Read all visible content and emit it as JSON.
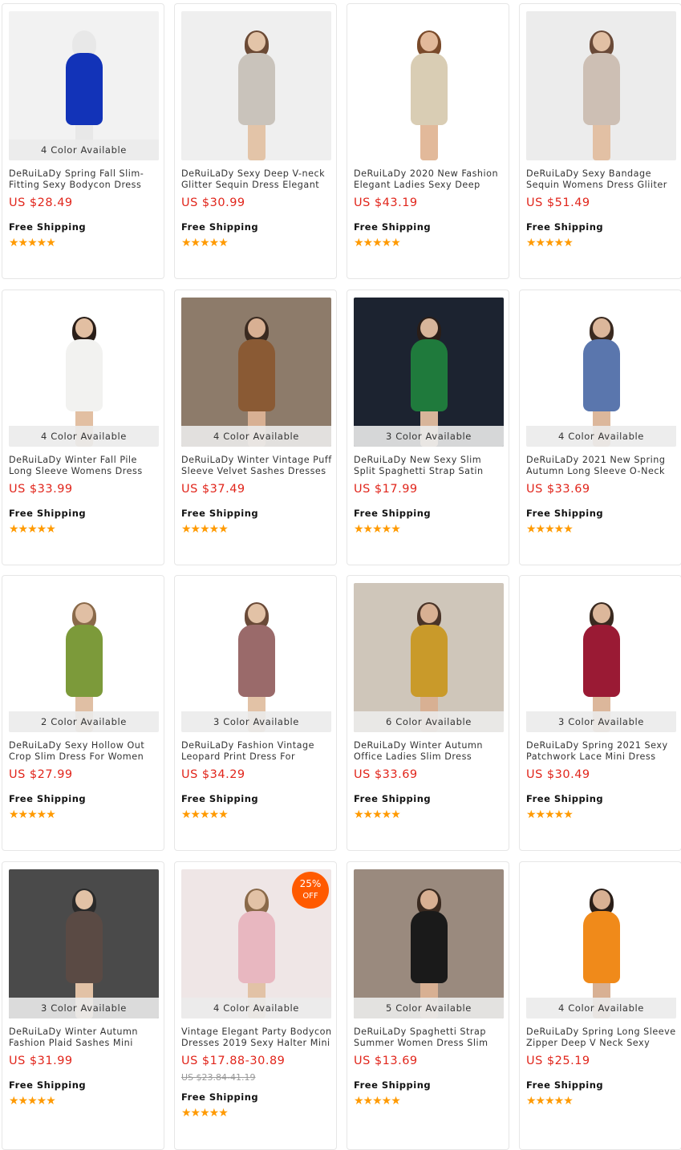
{
  "products": [
    {
      "name": "DeRuiLaDy Spring Fall Slim-Fitting Sexy Bodycon Dress For",
      "price": "US $28.49",
      "colors": "4 Color Available",
      "shipping": "Free Shipping",
      "rating": "★★★★★",
      "bg": "#f2f2f2",
      "dress": "#1233b8",
      "skin": "#e8e8e8",
      "hair": "#e8e8e8"
    },
    {
      "name": "DeRuiLaDy Sexy Deep V-neck Glitter Sequin Dress Elegant",
      "price": "US $30.99",
      "colors": "",
      "shipping": "Free Shipping",
      "rating": "★★★★★",
      "bg": "#efefef",
      "dress": "#c9c3bb",
      "skin": "#e3c4a8",
      "hair": "#6b4a35"
    },
    {
      "name": "DeRuiLaDy 2020 New Fashion Elegant Ladies Sexy Deep",
      "price": "US $43.19",
      "colors": "",
      "shipping": "Free Shipping",
      "rating": "★★★★★",
      "bg": "#ffffff",
      "dress": "#d9cdb4",
      "skin": "#e2b99a",
      "hair": "#7a4a2a"
    },
    {
      "name": "DeRuiLaDy Sexy Bandage Sequin Womens Dress Gliiter",
      "price": "US $51.49",
      "colors": "",
      "shipping": "Free Shipping",
      "rating": "★★★★★",
      "bg": "#ececec",
      "dress": "#cdbfb4",
      "skin": "#e2c0a4",
      "hair": "#6a4a38"
    },
    {
      "name": "DeRuiLaDy Winter Fall Pile Long Sleeve Womens Dress Vintage",
      "price": "US $33.99",
      "colors": "4 Color Available",
      "shipping": "Free Shipping",
      "rating": "★★★★★",
      "bg": "#ffffff",
      "dress": "#f2f2f0",
      "skin": "#e2bfa2",
      "hair": "#2a1e18"
    },
    {
      "name": "DeRuiLaDy Winter Vintage Puff Sleeve Velvet Sashes Dresses",
      "price": "US $37.49",
      "colors": "4 Color Available",
      "shipping": "Free Shipping",
      "rating": "★★★★★",
      "bg": "#8d7b6a",
      "dress": "#8a5a34",
      "skin": "#d8b093",
      "hair": "#3a2a20"
    },
    {
      "name": "DeRuiLaDy New Sexy Slim Split Spaghetti Strap Satin Dress For",
      "price": "US $17.99",
      "colors": "3 Color Available",
      "shipping": "Free Shipping",
      "rating": "★★★★★",
      "bg": "#1c2330",
      "dress": "#1f7a3c",
      "skin": "#d8b59a",
      "hair": "#2a1e18"
    },
    {
      "name": "DeRuiLaDy 2021 New Spring Autumn Long Sleeve O-Neck",
      "price": "US $33.69",
      "colors": "4 Color Available",
      "shipping": "Free Shipping",
      "rating": "★★★★★",
      "bg": "#ffffff",
      "dress": "#5a76ad",
      "skin": "#dcb79b",
      "hair": "#3a2a20"
    },
    {
      "name": "DeRuiLaDy Sexy Hollow Out Crop Slim Dress For Women",
      "price": "US $27.99",
      "colors": "2 Color Available",
      "shipping": "Free Shipping",
      "rating": "★★★★★",
      "bg": "#ffffff",
      "dress": "#7c9a3a",
      "skin": "#e0bfa4",
      "hair": "#8a6a4a"
    },
    {
      "name": "DeRuiLaDy Fashion Vintage Leopard Print Dress For Women",
      "price": "US $34.29",
      "colors": "3 Color Available",
      "shipping": "Free Shipping",
      "rating": "★★★★★",
      "bg": "#ffffff",
      "dress": "#9a6a6a",
      "skin": "#e2c2a6",
      "hair": "#6a4a38"
    },
    {
      "name": "DeRuiLaDy Winter Autumn Office Ladies Slim Dress Casual",
      "price": "US $33.69",
      "colors": "6 Color Available",
      "shipping": "Free Shipping",
      "rating": "★★★★★",
      "bg": "#cfc6ba",
      "dress": "#c99a2a",
      "skin": "#d8b093",
      "hair": "#4a3428"
    },
    {
      "name": "DeRuiLaDy Spring 2021 Sexy Patchwork Lace Mini Dress",
      "price": "US $30.49",
      "colors": "3 Color Available",
      "shipping": "Free Shipping",
      "rating": "★★★★★",
      "bg": "#ffffff",
      "dress": "#9a1a34",
      "skin": "#dcb79b",
      "hair": "#3a2a20"
    },
    {
      "name": "DeRuiLaDy Winter Autumn Fashion Plaid Sashes Mini Dress",
      "price": "US $31.99",
      "colors": "3 Color Available",
      "shipping": "Free Shipping",
      "rating": "★★★★★",
      "bg": "#4a4a4a",
      "dress": "#5a4a44",
      "skin": "#e2c2a6",
      "hair": "#2a2a2a"
    },
    {
      "name": "Vintage Elegant Party Bodycon Dresses 2019 Sexy Halter Mini",
      "price": "US $17.88-30.89",
      "orig": "US $23.84-41.19",
      "discount": "25%",
      "discount_label": "OFF",
      "colors": "4 Color Available",
      "shipping": "Free Shipping",
      "rating": "★★★★★",
      "bg": "#efe6e6",
      "dress": "#e8b7c0",
      "skin": "#e2c2a6",
      "hair": "#8a6a4a"
    },
    {
      "name": "DeRuiLaDy Spaghetti Strap Summer Women Dress Slim",
      "price": "US $13.69",
      "colors": "5 Color Available",
      "shipping": "Free Shipping",
      "rating": "★★★★★",
      "bg": "#9a8a7e",
      "dress": "#1a1a1a",
      "skin": "#d8b093",
      "hair": "#3a2a20"
    },
    {
      "name": "DeRuiLaDy Spring Long Sleeve Zipper Deep V Neck Sexy Dress",
      "price": "US $25.19",
      "colors": "4 Color Available",
      "shipping": "Free Shipping",
      "rating": "★★★★★",
      "bg": "#ffffff",
      "dress": "#f08a1a",
      "skin": "#d8b093",
      "hair": "#2a1e18"
    }
  ]
}
